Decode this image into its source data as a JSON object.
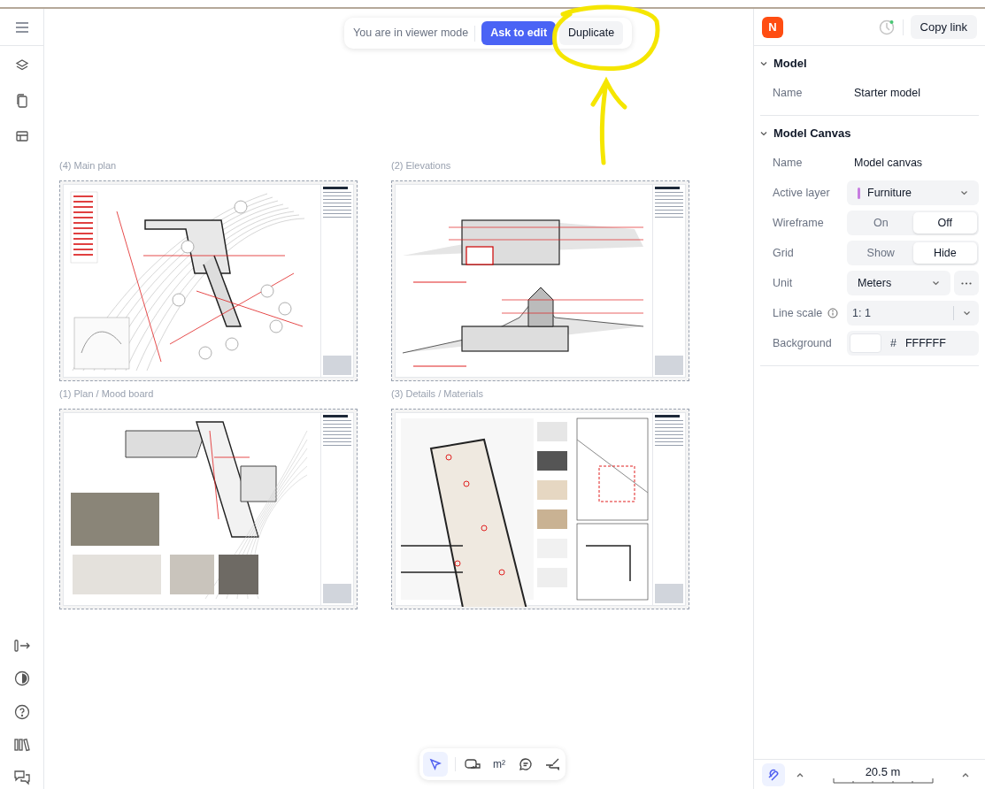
{
  "top_bar": {
    "notice": "You are in viewer mode",
    "buttons": [
      {
        "label": "Ask to edit",
        "kind": "primary"
      },
      {
        "label": "Duplicate",
        "kind": "secondary"
      }
    ]
  },
  "sheets": [
    {
      "label": "(4) Main plan",
      "kind": "plan"
    },
    {
      "label": "(2) Elevations",
      "kind": "elevation"
    },
    {
      "label": "(1) Plan / Mood board",
      "kind": "moodboard"
    },
    {
      "label": "(3) Details / Materials",
      "kind": "details"
    }
  ],
  "tools": [
    {
      "kind": "select",
      "selected": true
    },
    {
      "kind": "measure",
      "selected": false
    },
    {
      "kind": "area",
      "label": "m²",
      "selected": false
    },
    {
      "kind": "comment",
      "selected": false
    },
    {
      "kind": "markup",
      "selected": false
    }
  ],
  "right_panel": {
    "avatar": "N",
    "copy_link": "Copy link",
    "sections": [
      {
        "title": "Model",
        "expanded": true,
        "rows": [
          {
            "kind": "text",
            "label": "Name",
            "value": "Starter model"
          }
        ]
      },
      {
        "title": "Model Canvas",
        "expanded": true,
        "rows": [
          {
            "kind": "text",
            "label": "Name",
            "value": "Model canvas"
          },
          {
            "kind": "layer",
            "label": "Active layer",
            "value": "Furniture",
            "color": "#c77de0"
          },
          {
            "kind": "toggle",
            "label": "Wireframe",
            "options": [
              {
                "label": "On",
                "selected": false
              },
              {
                "label": "Off",
                "selected": true
              }
            ]
          },
          {
            "kind": "toggle",
            "label": "Grid",
            "options": [
              {
                "label": "Show",
                "selected": false
              },
              {
                "label": "Hide",
                "selected": true
              }
            ]
          },
          {
            "kind": "select",
            "label": "Unit",
            "value": "Meters"
          },
          {
            "kind": "scale",
            "label": "Line scale",
            "value": "1: 1"
          },
          {
            "kind": "color",
            "label": "Background",
            "hash": "#",
            "value": "FFFFFF"
          }
        ]
      }
    ]
  },
  "scale_bar": {
    "reading": "20.5 m"
  }
}
